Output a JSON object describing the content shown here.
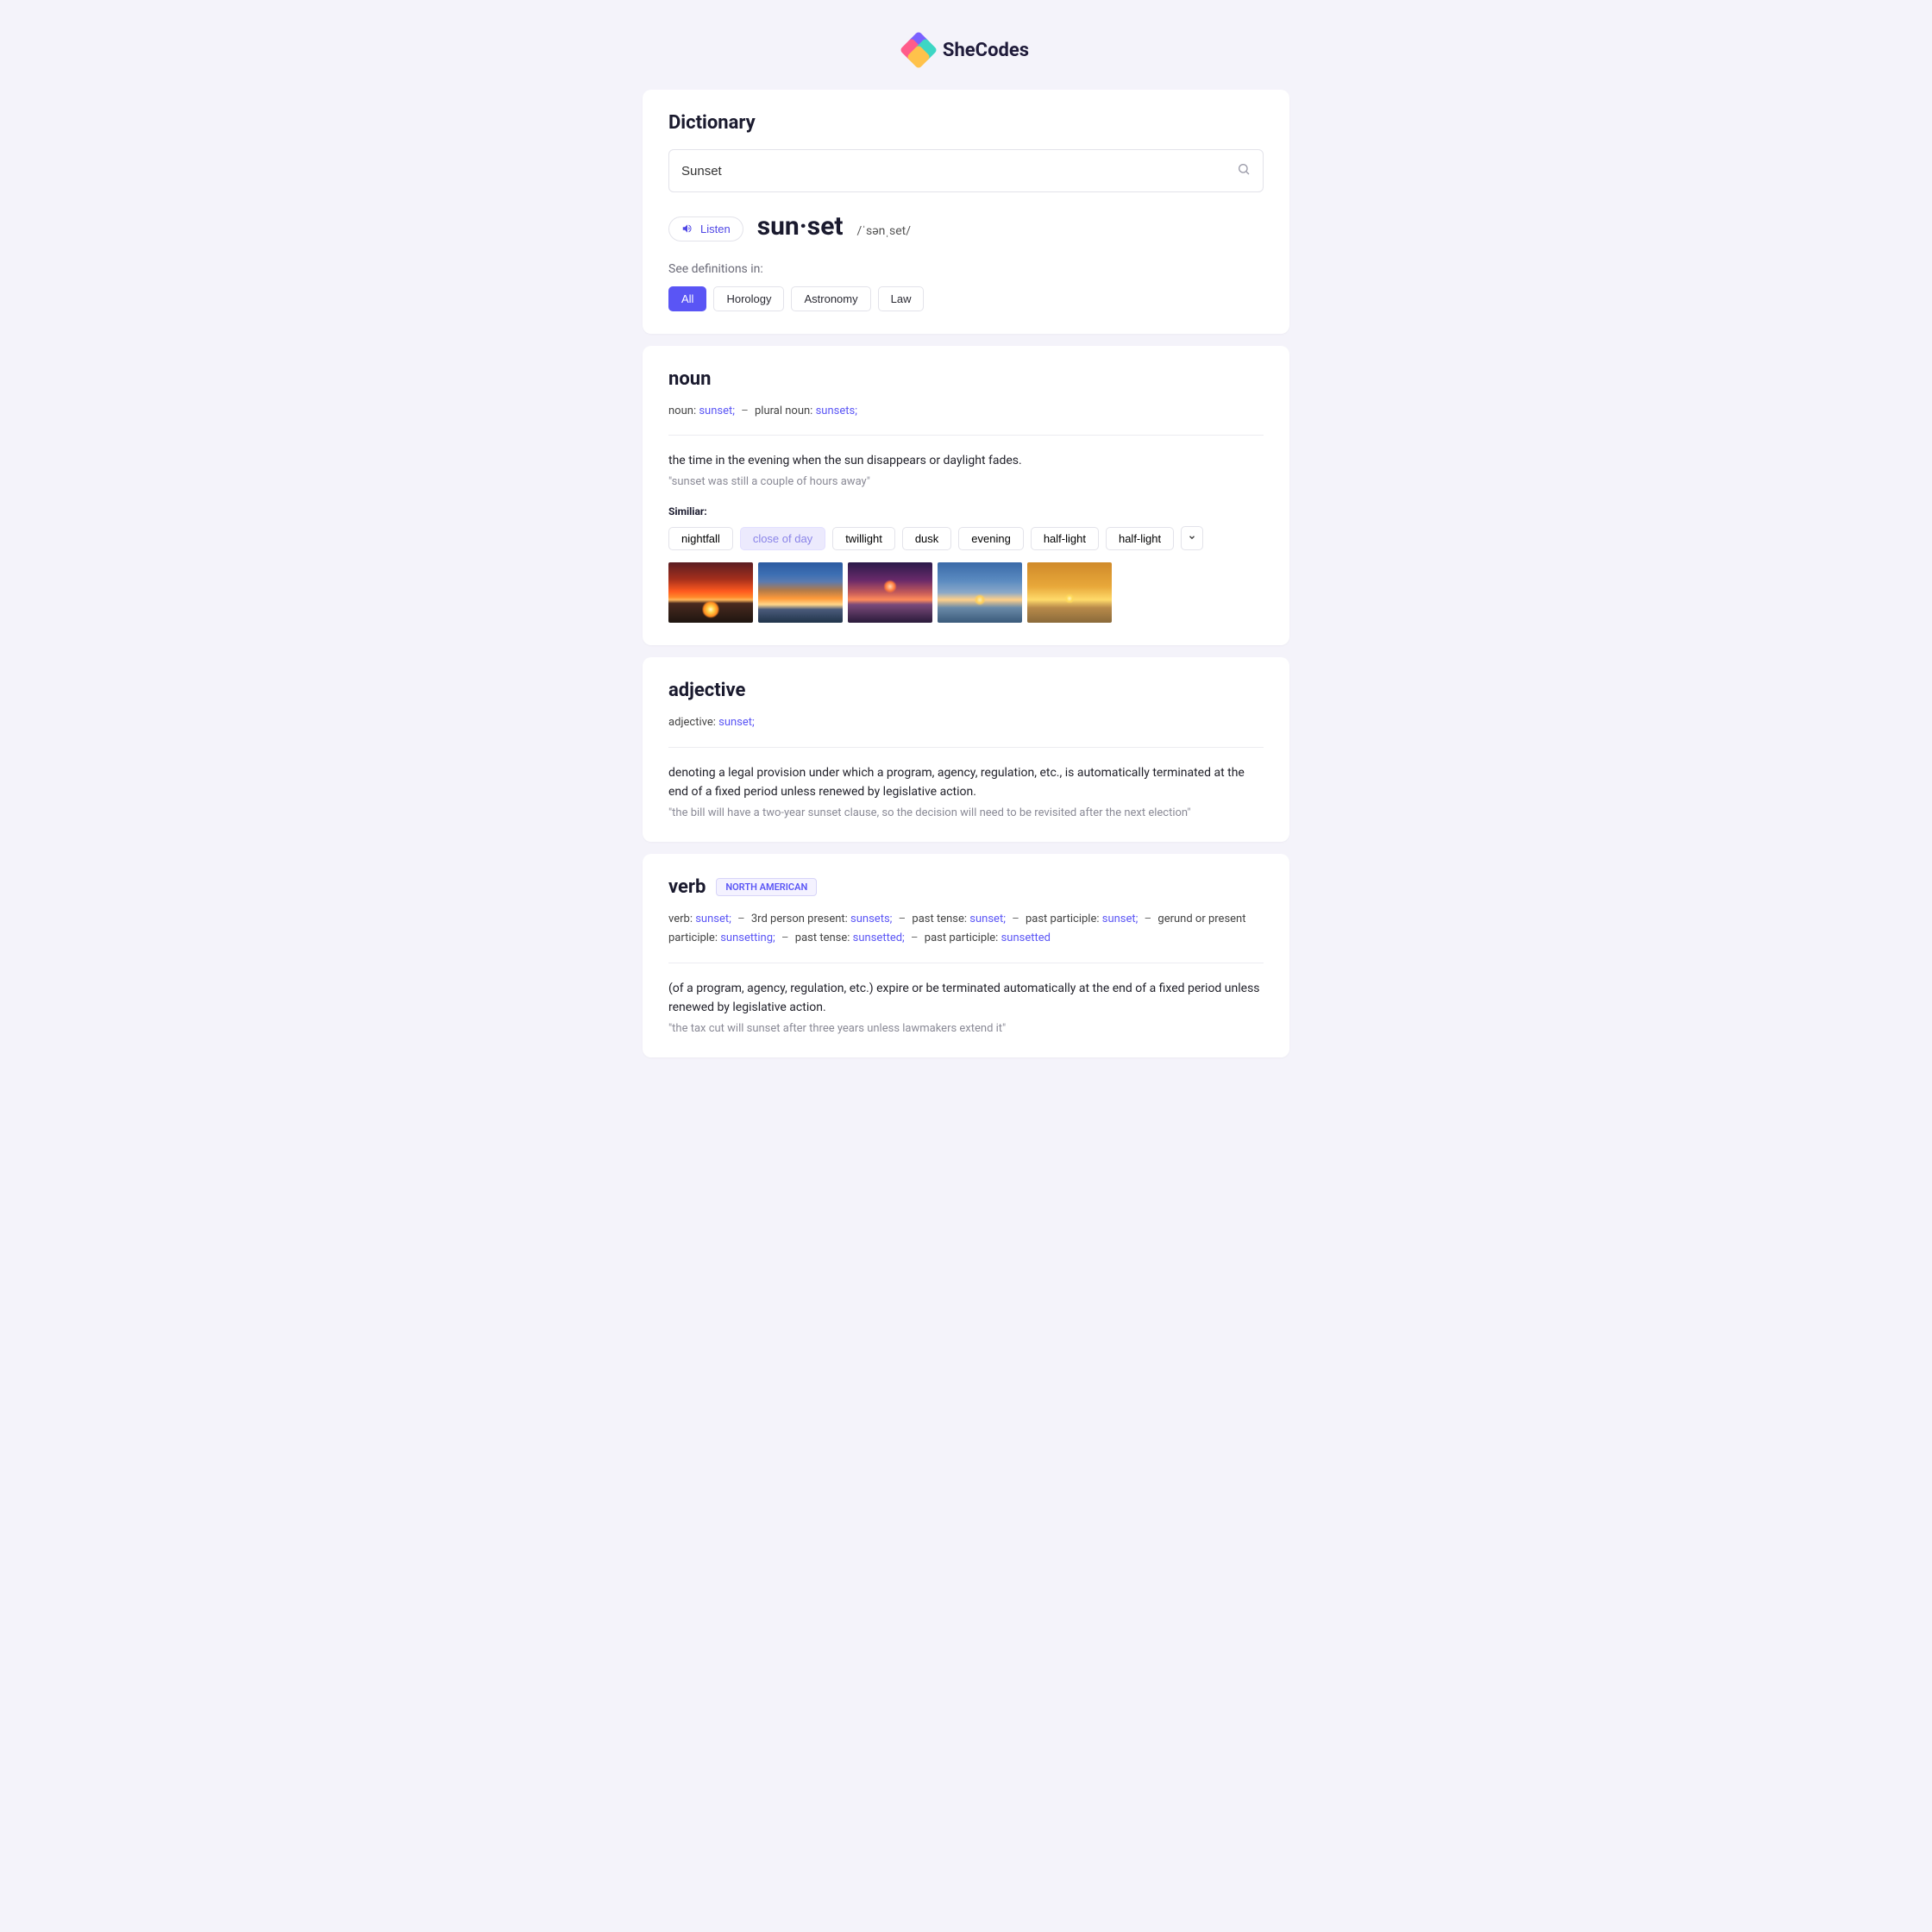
{
  "logo_text": "SheCodes",
  "header": {
    "title": "Dictionary",
    "search_value": "Sunset"
  },
  "listen_label": "Listen",
  "headword": "sun·set",
  "phonetic": "/ˈsənˌset/",
  "see_definitions_label": "See definitions in:",
  "category_chips": [
    "All",
    "Horology",
    "Astronomy",
    "Law"
  ],
  "noun": {
    "heading": "noun",
    "forms": [
      {
        "label": "noun:",
        "value": "sunset"
      },
      {
        "label": "plural noun:",
        "value": "sunsets"
      }
    ],
    "definition": "the time in the evening when the sun disappears or daylight fades.",
    "example": "\"sunset was still a couple of hours away\"",
    "similar_label": "Similiar:",
    "similar": [
      "nightfall",
      "close of day",
      "twillight",
      "dusk",
      "evening",
      "half-light",
      "half-light"
    ]
  },
  "adjective": {
    "heading": "adjective",
    "forms": [
      {
        "label": "adjective:",
        "value": "sunset"
      }
    ],
    "definition": "denoting a legal provision under which a program, agency, regulation, etc., is automatically terminated at the end of a fixed period unless renewed by legislative action.",
    "example": "\"the bill will have a two-year sunset clause, so the decision will need to be revisited after the next election\""
  },
  "verb": {
    "heading": "verb",
    "region": "NORTH AMERICAN",
    "forms": [
      {
        "label": "verb:",
        "value": "sunset"
      },
      {
        "label": "3rd person present:",
        "value": "sunsets"
      },
      {
        "label": "past tense:",
        "value": "sunset"
      },
      {
        "label": "past participle:",
        "value": "sunset"
      },
      {
        "label": "gerund or present participle:",
        "value": "sunsetting"
      },
      {
        "label": "past tense:",
        "value": "sunsetted"
      },
      {
        "label": "past participle:",
        "value": "sunsetted"
      }
    ],
    "definition": "(of a program, agency, regulation, etc.) expire or be terminated automatically at the end of a fixed period unless renewed by legislative action.",
    "example": "\"the tax cut will sunset after three years unless lawmakers extend it\""
  }
}
